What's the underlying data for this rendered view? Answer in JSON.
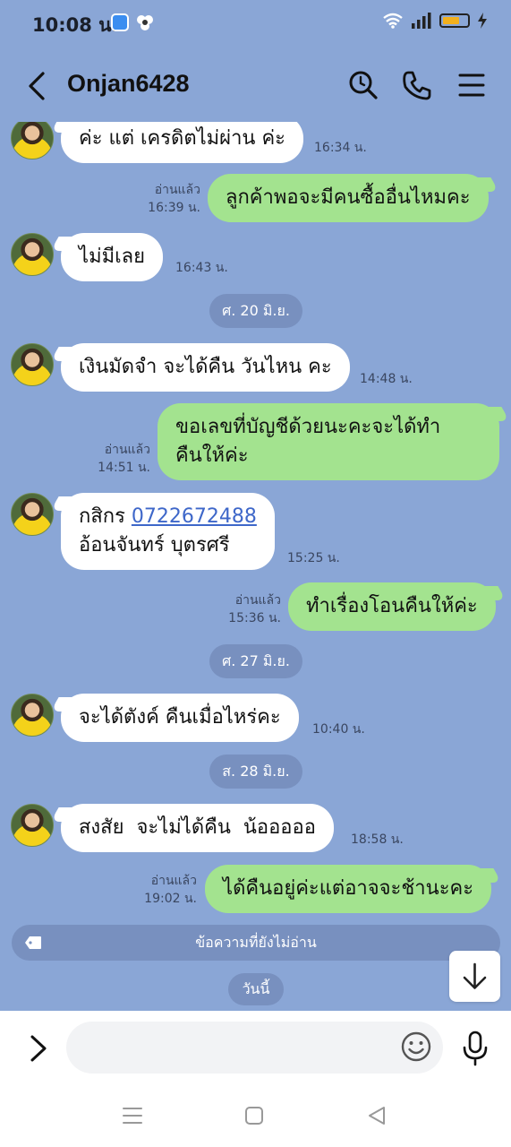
{
  "status_bar": {
    "time": "10:08 น.",
    "battery_color": "#f2b01e"
  },
  "header": {
    "title": "Onjan6428",
    "icons": [
      "back-icon",
      "search-icon",
      "phone-icon",
      "menu-icon"
    ]
  },
  "messages": [
    {
      "dir": "in",
      "lines": [
        "ค่ะ แต่ เครดิตไม่ผ่าน ค่ะ"
      ],
      "time": "16:34 น."
    },
    {
      "dir": "out",
      "lines": [
        "ลูกค้าพอจะมีคนซื้ออื่นไหมคะ"
      ],
      "read": "อ่านแล้ว",
      "time": "16:39 น."
    },
    {
      "dir": "in",
      "lines": [
        "ไม่มีเลย"
      ],
      "time": "16:43 น."
    },
    {
      "date": "ศ. 20 มิ.ย."
    },
    {
      "dir": "in",
      "lines": [
        "เงินมัดจำ จะได้คืน วันไหน คะ"
      ],
      "time": "14:48 น."
    },
    {
      "dir": "out",
      "lines": [
        "ขอเลขที่บัญชีด้วยนะคะจะได้ทำ",
        "คืนให้ค่ะ"
      ],
      "read": "อ่านแล้ว",
      "time": "14:51 น."
    },
    {
      "dir": "in",
      "bank": "กสิกร",
      "account": "0722672488",
      "name": "อ้อนจันทร์ บุตรศรี",
      "time": "15:25 น."
    },
    {
      "dir": "out",
      "lines": [
        "ทำเรื่องโอนคืนให้ค่ะ"
      ],
      "read": "อ่านแล้ว",
      "time": "15:36 น."
    },
    {
      "date": "ศ. 27 มิ.ย."
    },
    {
      "dir": "in",
      "lines": [
        "จะได้ตังค์ คืนเมื่อไหร่คะ"
      ],
      "time": "10:40 น."
    },
    {
      "date": "ส. 28 มิ.ย."
    },
    {
      "dir": "in",
      "lines": [
        "สงสัย  จะไม่ได้คืน  น้อออออ"
      ],
      "time": "18:58 น."
    },
    {
      "dir": "out",
      "lines": [
        "ได้คืนอยู่ค่ะแต่อาจจะช้านะคะ"
      ],
      "read": "อ่านแล้ว",
      "time": "19:02 น."
    }
  ],
  "unread_bar": "ข้อความที่ยังไม่อ่าน",
  "today": "วันนี้",
  "input": {
    "value": "",
    "placeholder": ""
  },
  "colors": {
    "background": "#8aa6d6",
    "incoming_bubble": "#ffffff",
    "outgoing_bubble": "#a3e38f",
    "pill": "#7890bf",
    "link": "#3e67c9"
  }
}
